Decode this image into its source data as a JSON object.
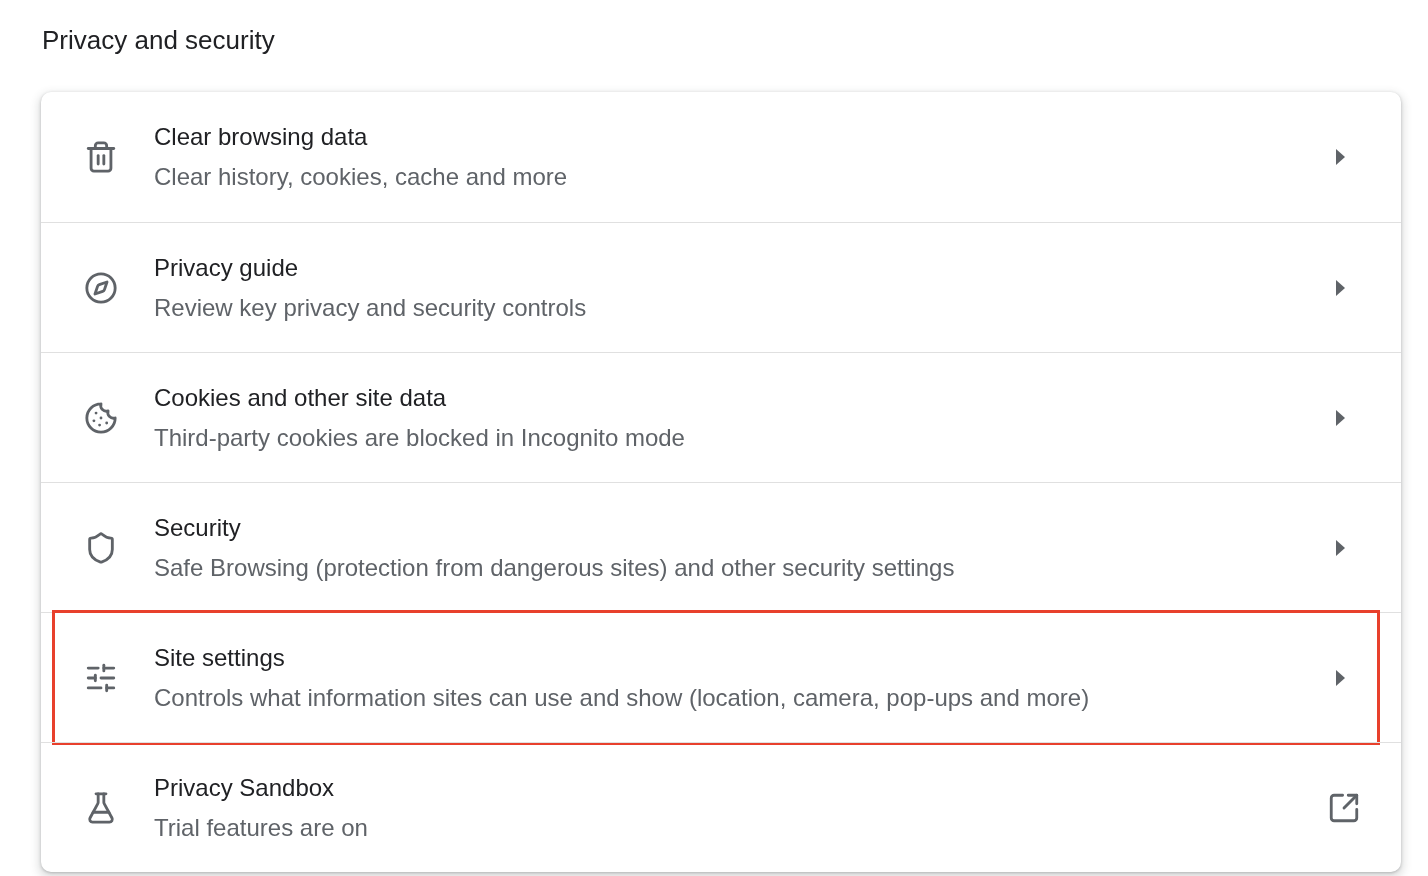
{
  "section_title": "Privacy and security",
  "items": [
    {
      "title": "Clear browsing data",
      "subtitle": "Clear history, cookies, cache and more",
      "kind": "submenu",
      "highlighted": false
    },
    {
      "title": "Privacy guide",
      "subtitle": "Review key privacy and security controls",
      "kind": "submenu",
      "highlighted": false
    },
    {
      "title": "Cookies and other site data",
      "subtitle": "Third-party cookies are blocked in Incognito mode",
      "kind": "submenu",
      "highlighted": false
    },
    {
      "title": "Security",
      "subtitle": "Safe Browsing (protection from dangerous sites) and other security settings",
      "kind": "submenu",
      "highlighted": false
    },
    {
      "title": "Site settings",
      "subtitle": "Controls what information sites can use and show (location, camera, pop-ups and more)",
      "kind": "submenu",
      "highlighted": true
    },
    {
      "title": "Privacy Sandbox",
      "subtitle": "Trial features are on",
      "kind": "external",
      "highlighted": false
    }
  ]
}
